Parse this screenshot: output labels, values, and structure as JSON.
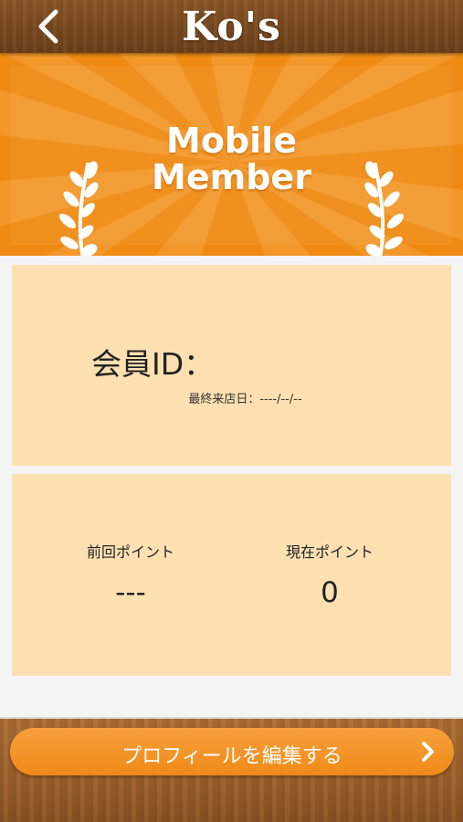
{
  "header": {
    "logo_text": "Ko's",
    "back_icon": "chevron-left-icon"
  },
  "banner": {
    "title_line1": "Mobile",
    "title_line2": "Member",
    "decoration_icon": "laurel-icon"
  },
  "member_card": {
    "member_id_label": "会員ID：",
    "last_visit": "最終来店日：----/--/--"
  },
  "points_card": {
    "previous_label": "前回ポイント",
    "previous_value": "---",
    "current_label": "現在ポイント",
    "current_value": "0"
  },
  "footer": {
    "edit_profile_label": "プロフィールを編集する",
    "edit_icon": "chevron-right-icon"
  },
  "colors": {
    "banner_orange": "#f08a12",
    "card_cream": "#fde0b1",
    "wood_dark": "#7a4a20",
    "wood_light": "#a0622c"
  }
}
